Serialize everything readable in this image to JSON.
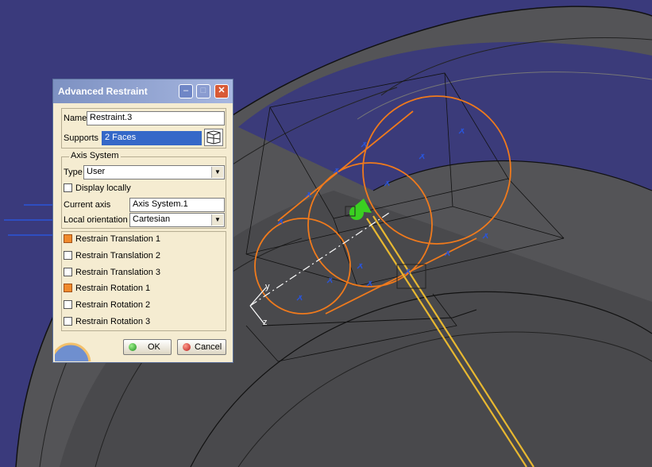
{
  "dialog": {
    "title": "Advanced Restraint",
    "name_label": "Name",
    "name_value": "Restraint.3",
    "supports_label": "Supports",
    "supports_value": "2 Faces",
    "axis_group_label": "Axis System",
    "type_label": "Type",
    "type_value": "User",
    "display_locally_label": "Display locally",
    "current_axis_label": "Current axis",
    "current_axis_value": "Axis System.1",
    "local_orientation_label": "Local orientation",
    "local_orientation_value": "Cartesian",
    "restraints": [
      {
        "label": "Restrain Translation 1",
        "checked": true
      },
      {
        "label": "Restrain Translation 2",
        "checked": false
      },
      {
        "label": "Restrain Translation 3",
        "checked": false
      },
      {
        "label": "Restrain Rotation 1",
        "checked": true
      },
      {
        "label": "Restrain Rotation 2",
        "checked": false
      },
      {
        "label": "Restrain Rotation 3",
        "checked": false
      }
    ],
    "ok_label": "OK",
    "cancel_label": "Cancel"
  },
  "viewport": {
    "axis_y_label": "y",
    "axis_z_label": "z"
  },
  "colors": {
    "background": "#3a3a7c",
    "part_gray": "#5b5b5d",
    "constraint_orange": "#f07a1c",
    "accent_blue": "#2a54d8",
    "accent_green": "#3ad021"
  }
}
